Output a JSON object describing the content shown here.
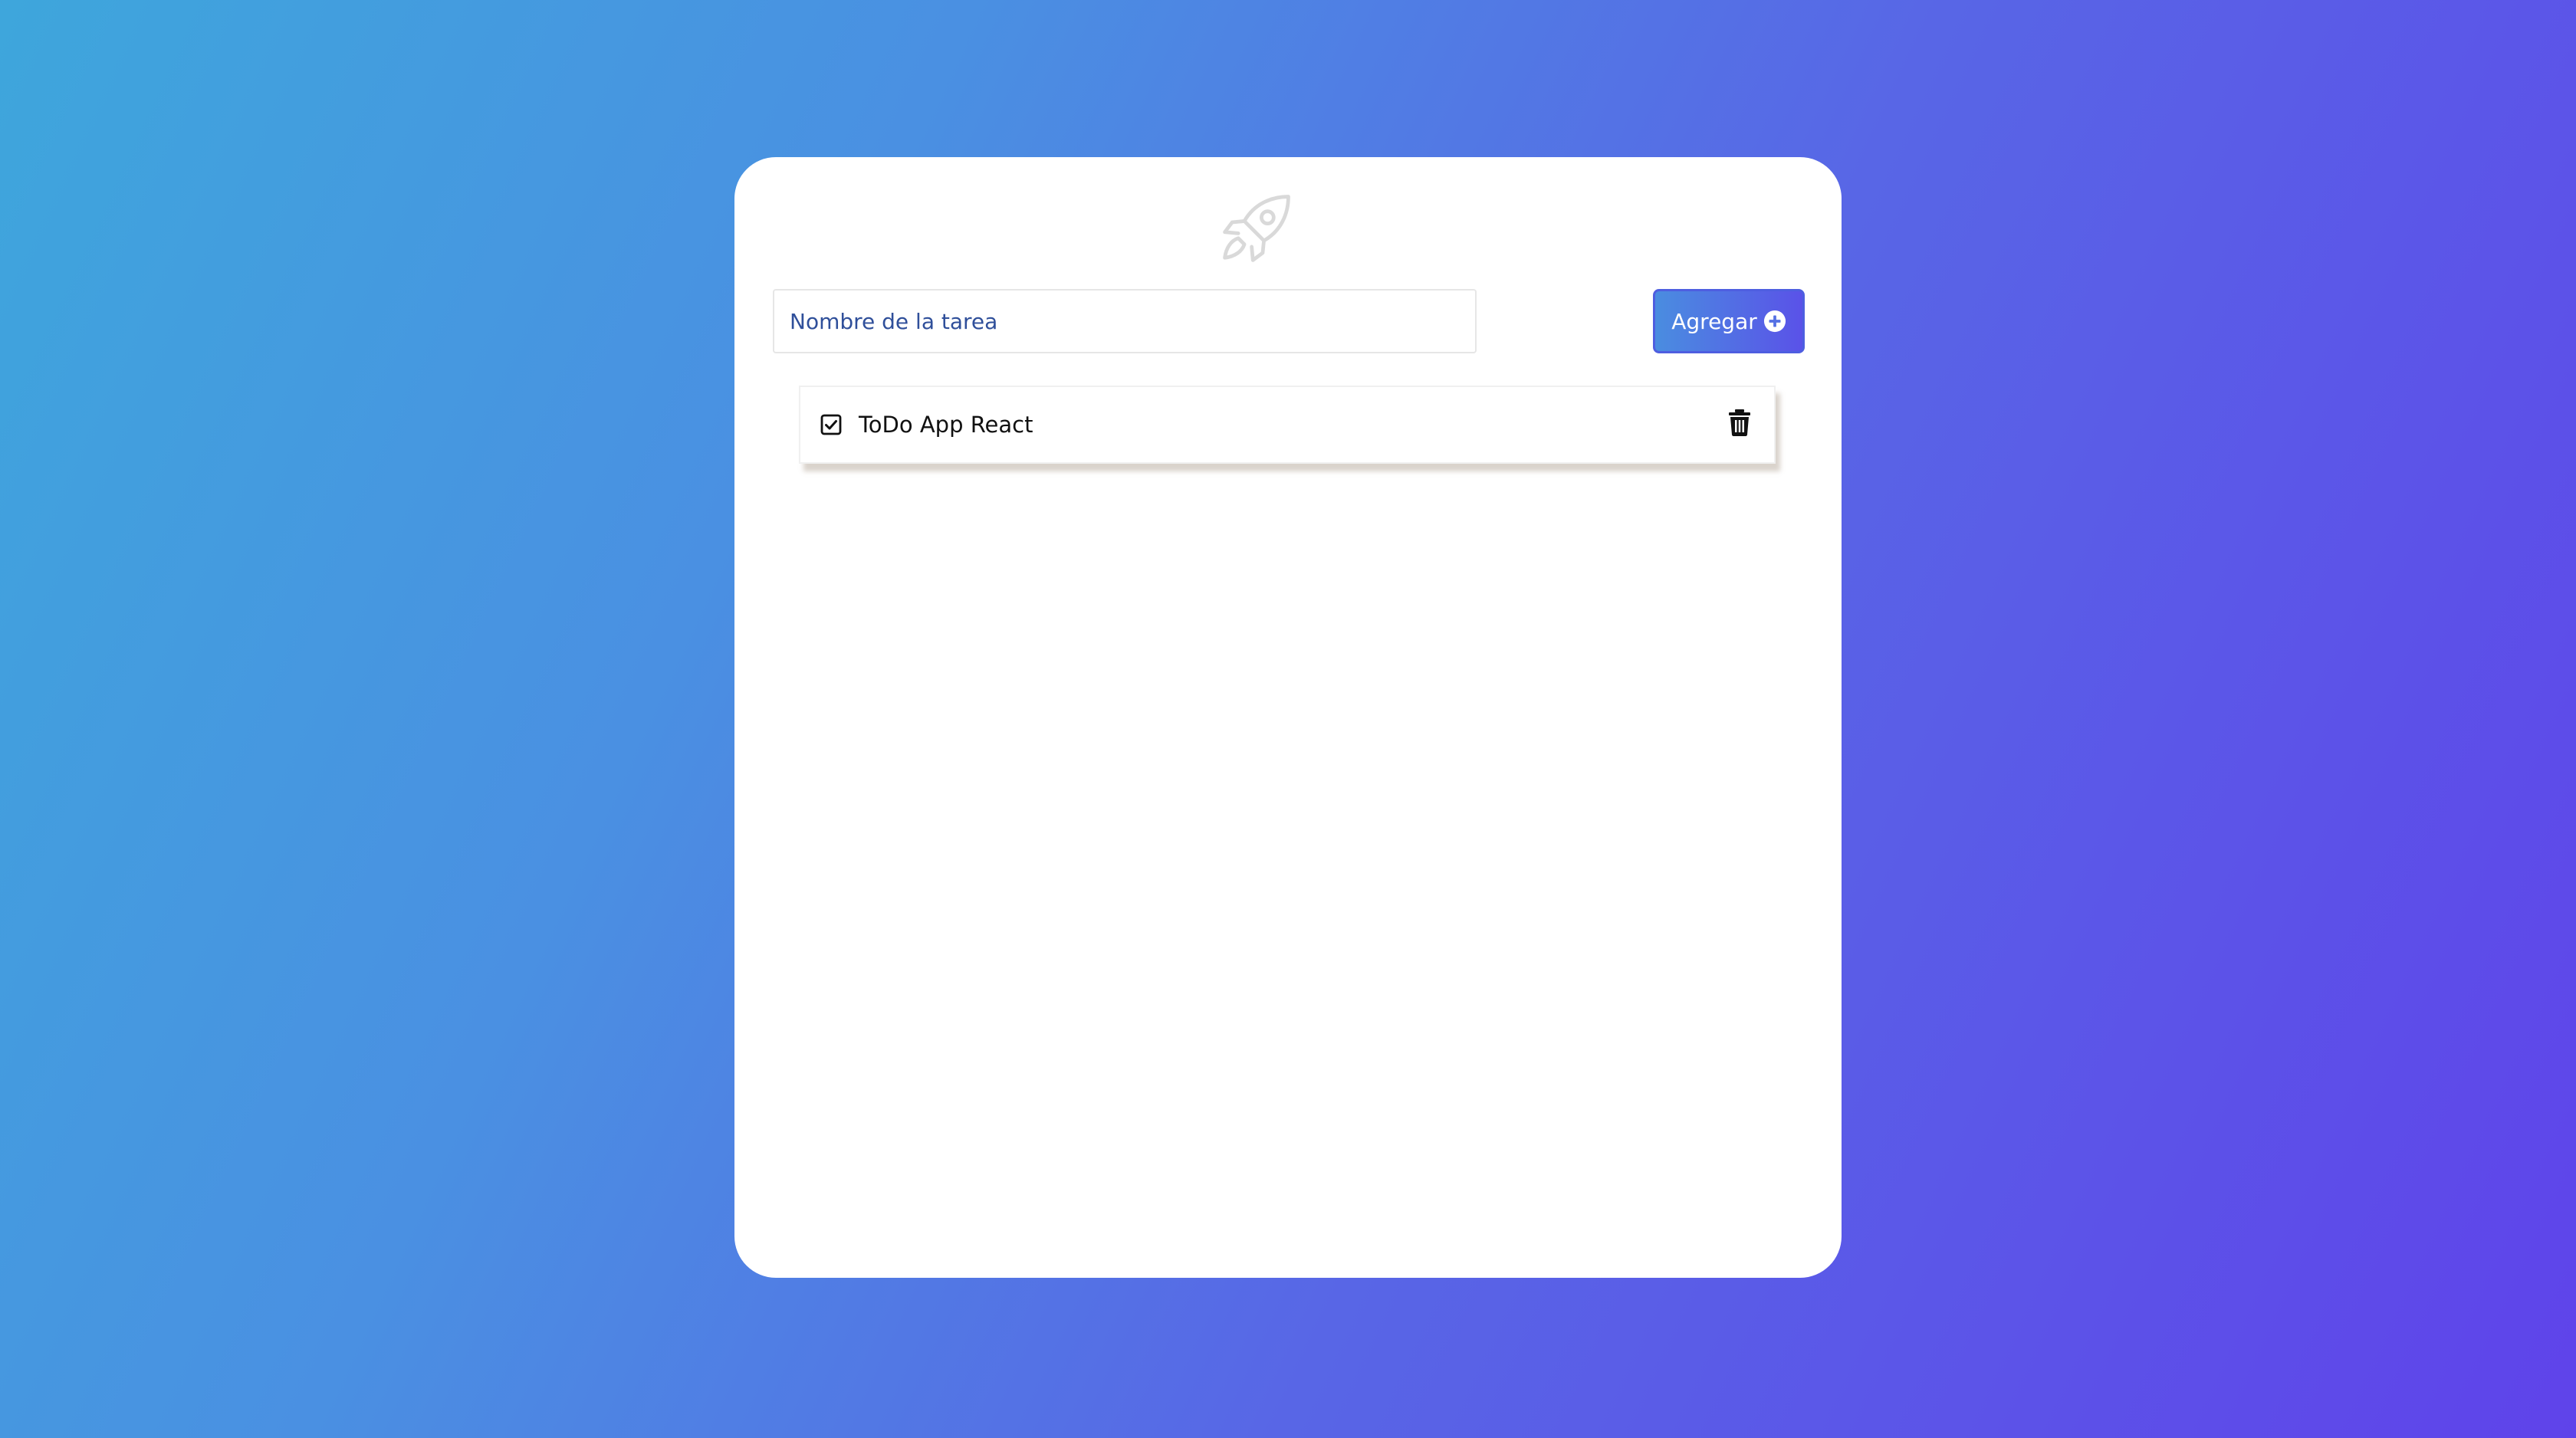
{
  "card": {
    "logo_icon": "rocket-icon"
  },
  "form": {
    "input_placeholder": "Nombre de la tarea",
    "input_value": "",
    "add_label": "Agregar",
    "add_icon": "plus-circle-icon"
  },
  "tasks": [
    {
      "label": "ToDo App React",
      "checked": true,
      "check_icon": "checkbox-checked-icon",
      "delete_icon": "trash-icon"
    }
  ],
  "colors": {
    "background_start": "#3ea6dc",
    "background_end": "#5f43ea",
    "button_start": "#4a8de0",
    "button_end": "#5a52e8",
    "placeholder": "#2f4f9a"
  }
}
